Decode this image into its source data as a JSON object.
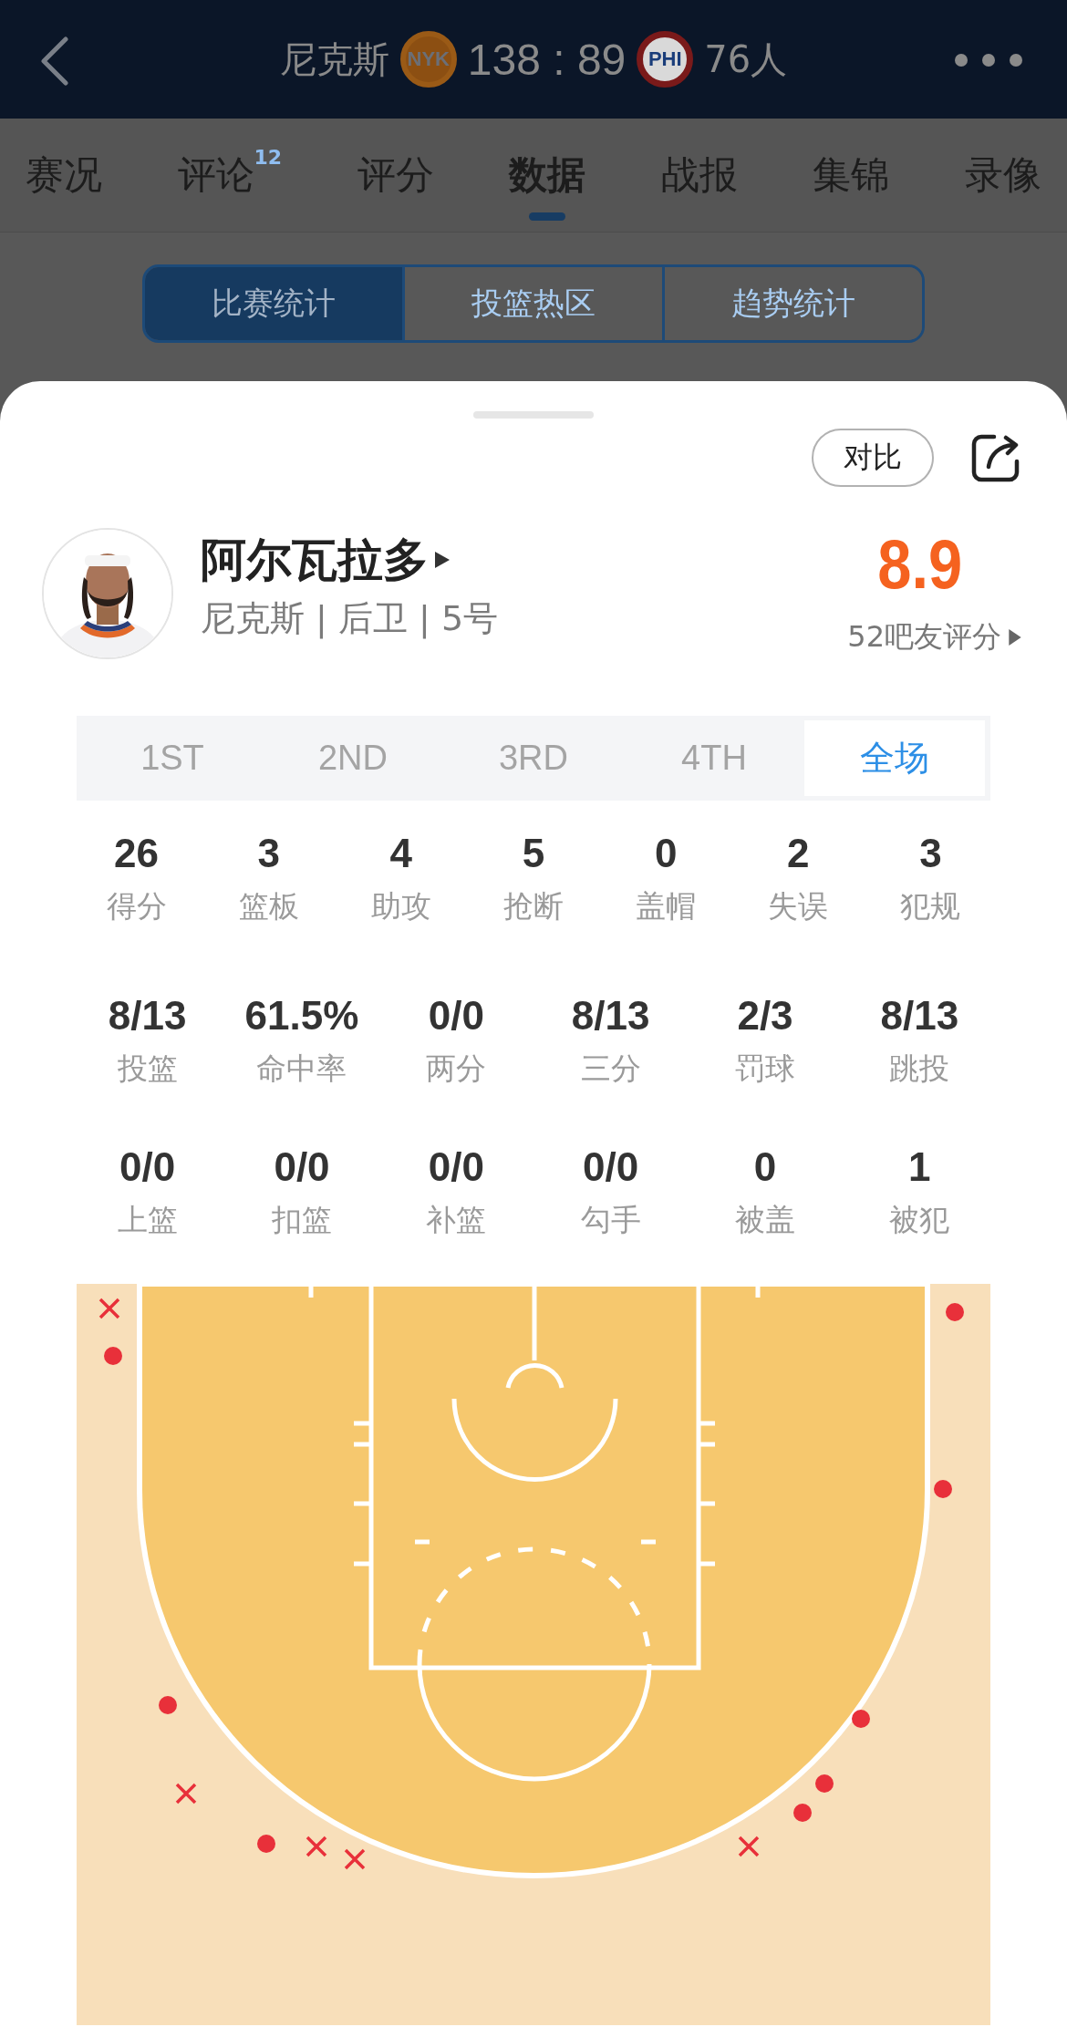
{
  "header": {
    "team_home": "尼克斯",
    "home_logo": "NYK",
    "score": "138 : 89",
    "away_logo": "PHI",
    "team_away": "76人"
  },
  "tabs": [
    {
      "label": "赛况",
      "selected": false
    },
    {
      "label": "评论",
      "badge": "12",
      "selected": false
    },
    {
      "label": "评分",
      "selected": false
    },
    {
      "label": "数据",
      "selected": true
    },
    {
      "label": "战报",
      "selected": false
    },
    {
      "label": "集锦",
      "selected": false
    },
    {
      "label": "录像",
      "selected": false
    }
  ],
  "segments": [
    {
      "label": "比赛统计",
      "selected": true
    },
    {
      "label": "投篮热区",
      "selected": false
    },
    {
      "label": "趋势统计",
      "selected": false
    }
  ],
  "compare_button": "对比",
  "player": {
    "name": "阿尔瓦拉多",
    "info": "尼克斯 | 后卫 | 5号",
    "rating": "8.9",
    "rating_note": "52吧友评分"
  },
  "periods": [
    {
      "label": "1ST",
      "selected": false
    },
    {
      "label": "2ND",
      "selected": false
    },
    {
      "label": "3RD",
      "selected": false
    },
    {
      "label": "4TH",
      "selected": false
    },
    {
      "label": "全场",
      "selected": true
    }
  ],
  "stats_rows": [
    [
      {
        "value": "26",
        "label": "得分"
      },
      {
        "value": "3",
        "label": "篮板"
      },
      {
        "value": "4",
        "label": "助攻"
      },
      {
        "value": "5",
        "label": "抢断"
      },
      {
        "value": "0",
        "label": "盖帽"
      },
      {
        "value": "2",
        "label": "失误"
      },
      {
        "value": "3",
        "label": "犯规"
      }
    ],
    [
      {
        "value": "8/13",
        "label": "投篮"
      },
      {
        "value": "61.5%",
        "label": "命中率"
      },
      {
        "value": "0/0",
        "label": "两分"
      },
      {
        "value": "8/13",
        "label": "三分"
      },
      {
        "value": "2/3",
        "label": "罚球"
      },
      {
        "value": "8/13",
        "label": "跳投"
      }
    ],
    [
      {
        "value": "0/0",
        "label": "上篮"
      },
      {
        "value": "0/0",
        "label": "扣篮"
      },
      {
        "value": "0/0",
        "label": "补篮"
      },
      {
        "value": "0/0",
        "label": "勾手"
      },
      {
        "value": "0",
        "label": "被盖"
      },
      {
        "value": "1",
        "label": "被犯"
      }
    ]
  ],
  "shots": [
    {
      "made": false
    },
    {
      "made": true
    },
    {
      "made": true
    },
    {
      "made": true
    },
    {
      "made": true
    },
    {
      "made": false
    },
    {
      "made": true
    },
    {
      "made": false
    },
    {
      "made": false
    },
    {
      "made": false
    },
    {
      "made": true
    },
    {
      "made": true
    },
    {
      "made": true
    }
  ]
}
